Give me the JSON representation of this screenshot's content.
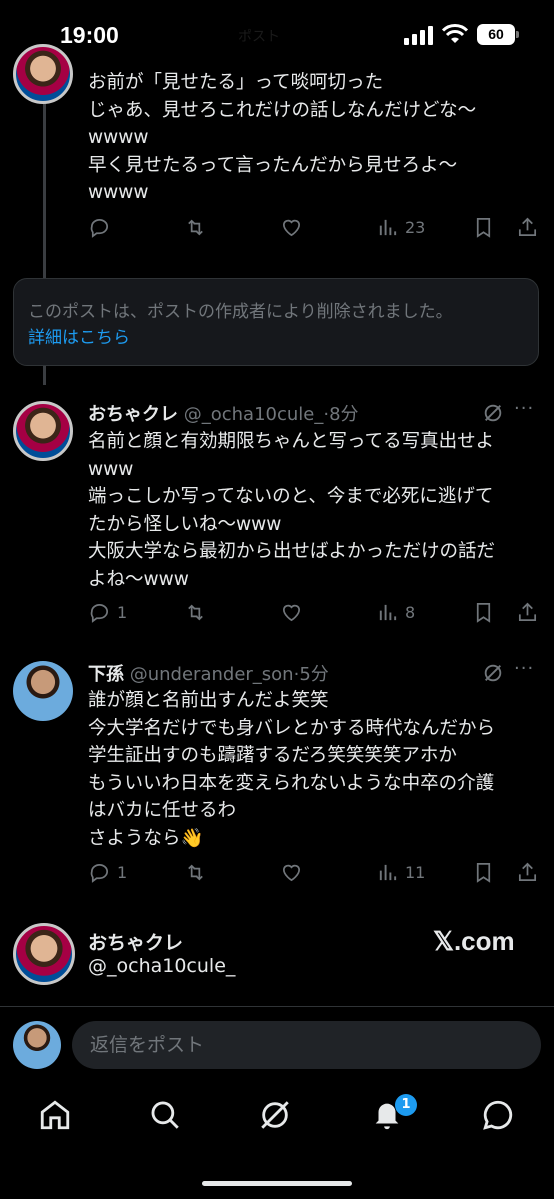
{
  "status_bar": {
    "time": "19:00",
    "battery": "60",
    "faded_header": "ポスト"
  },
  "posts": [
    {
      "text": "お前が「見せたる」って啖呵切った\nじゃあ、見せろこれだけの話しなんだけどな〜\nwwww\n早く見せたるって言ったんだから見せろよ〜\nwwww",
      "views": "23"
    }
  ],
  "deleted_notice": {
    "message": "このポストは、ポストの作成者により削除されました。",
    "link": "詳細はこちら"
  },
  "post2": {
    "name": "おちゃクレ",
    "handle": "@_ocha10cule_",
    "time": "·8分",
    "text": "名前と顔と有効期限ちゃんと写ってる写真出せよ\nwww\n端っこしか写ってないのと、今まで必死に逃げて\nたから怪しいね〜www\n大阪大学なら最初から出せばよかっただけの話だ\nよね〜www",
    "replies": "1",
    "views": "8"
  },
  "post3": {
    "name": "下孫",
    "handle": "@underander_son",
    "time": "·5分",
    "text": "誰が顔と名前出すんだよ笑笑\n今大学名だけでも身バレとかする時代なんだから\n学生証出すのも躊躇するだろ笑笑笑笑アホか\nもういいわ日本を変えられないような中卒の介護\nはバカに任せるわ\nさようなら👋",
    "replies": "1",
    "views": "11"
  },
  "profile_card": {
    "name": "おちゃクレ",
    "handle": "@_ocha10cule_",
    "brand": "𝕏.com"
  },
  "reply_box": {
    "placeholder": "返信をポスト"
  },
  "tabbar": {
    "notification_count": "1"
  }
}
